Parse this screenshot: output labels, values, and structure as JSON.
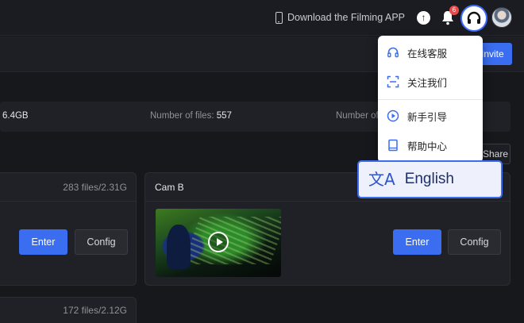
{
  "header": {
    "download_label": "Download the Filming APP",
    "notification_count": "6",
    "invite_label": "Invite"
  },
  "stats": {
    "size_value": "6.4GB",
    "files_label": "Number of files:",
    "files_value": "557",
    "partial_label": "Number of"
  },
  "share_label": "Share",
  "cards": [
    {
      "meta": "283 files/2.31G",
      "enter": "Enter",
      "config": "Config"
    },
    {
      "title": "Cam B",
      "enter": "Enter",
      "config": "Config"
    },
    {
      "meta": "172 files/2.12G"
    }
  ],
  "menu": {
    "items": [
      {
        "label": "在线客服",
        "icon": "headset-icon"
      },
      {
        "label": "关注我们",
        "icon": "scan-icon"
      },
      {
        "label": "新手引导",
        "icon": "play-circle-icon"
      },
      {
        "label": "帮助中心",
        "icon": "book-icon"
      }
    ],
    "language": {
      "label": "English",
      "icon": "translate-icon"
    }
  },
  "colors": {
    "accent": "#3a6df0",
    "background": "#17181c",
    "badge": "#e84a4a"
  }
}
